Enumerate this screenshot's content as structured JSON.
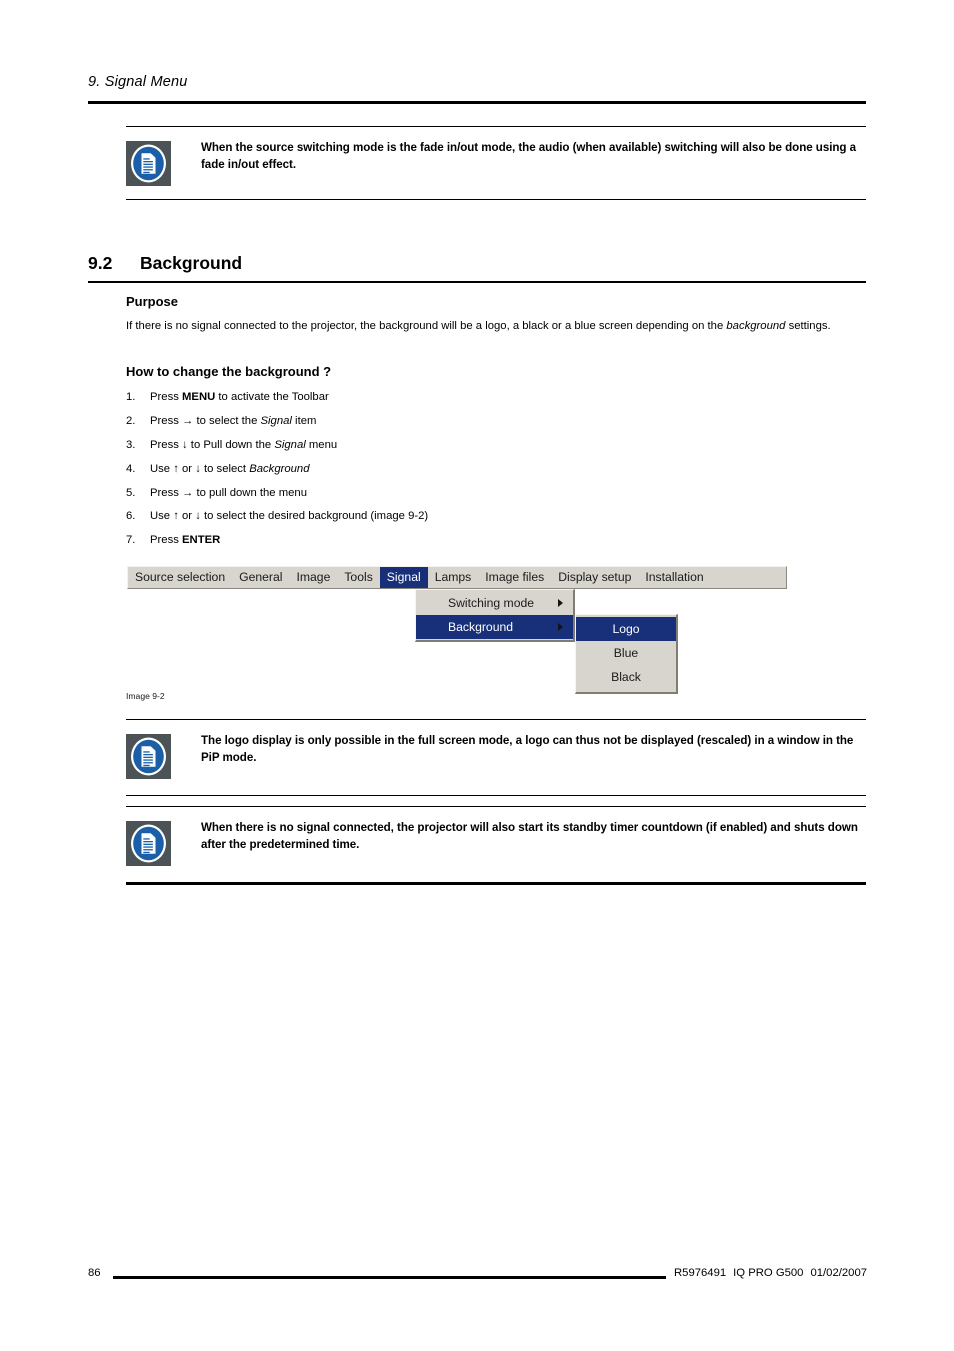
{
  "header": {
    "chapter_title": "9.  Signal Menu"
  },
  "notes": [
    {
      "icon": "note-document-icon",
      "text": "When the source switching mode is the fade in/out mode, the audio (when available) switching will also be done using a fade in/out effect."
    },
    {
      "icon": "note-document-icon",
      "text": "The logo display is only possible in the full screen mode, a logo can thus not be displayed (rescaled) in a window in the PiP mode."
    },
    {
      "icon": "note-document-icon",
      "text": "When there is no signal connected, the projector will also start its standby timer countdown (if enabled) and shuts down after the predetermined time."
    }
  ],
  "section": {
    "number": "9.2",
    "title": "Background"
  },
  "purpose": {
    "heading": "Purpose",
    "text_part1": "If there is no signal connected to the projector, the background will be a logo, a black or a blue screen depending on the ",
    "text_italic": "background",
    "text_part2": " settings."
  },
  "howto": {
    "heading": "How to change the background ?",
    "steps": [
      {
        "marker": "1.",
        "parts": [
          {
            "t": "Press ",
            "s": "normal"
          },
          {
            "t": "MENU",
            "s": "bold"
          },
          {
            "t": " to activate the Toolbar",
            "s": "normal"
          }
        ]
      },
      {
        "marker": "2.",
        "parts": [
          {
            "t": "Press → to select the ",
            "s": "normal"
          },
          {
            "t": "Signal",
            "s": "italic"
          },
          {
            "t": " item",
            "s": "normal"
          }
        ]
      },
      {
        "marker": "3.",
        "parts": [
          {
            "t": "Press ↓ to Pull down the ",
            "s": "normal"
          },
          {
            "t": "Signal",
            "s": "italic"
          },
          {
            "t": " menu",
            "s": "normal"
          }
        ]
      },
      {
        "marker": "4.",
        "parts": [
          {
            "t": "Use ↑ or ↓ to select ",
            "s": "normal"
          },
          {
            "t": "Background",
            "s": "italic"
          }
        ]
      },
      {
        "marker": "5.",
        "parts": [
          {
            "t": "Press → to pull down the menu",
            "s": "normal"
          }
        ]
      },
      {
        "marker": "6.",
        "parts": [
          {
            "t": "Use ↑ or ↓ to select the desired background (image 9-2)",
            "s": "normal"
          }
        ]
      },
      {
        "marker": "7.",
        "parts": [
          {
            "t": "Press ",
            "s": "normal"
          },
          {
            "t": "ENTER",
            "s": "bold"
          }
        ]
      }
    ]
  },
  "figure": {
    "caption": "Image 9-2",
    "colors": {
      "menu_face": "#d8d5ce",
      "highlight": "#18307a",
      "highlight_text": "#ffffff",
      "menu_text": "#1a1a1a"
    },
    "menubar": [
      {
        "label": "Source selection",
        "selected": false
      },
      {
        "label": "General",
        "selected": false
      },
      {
        "label": "Image",
        "selected": false
      },
      {
        "label": "Tools",
        "selected": false
      },
      {
        "label": "Signal",
        "selected": true
      },
      {
        "label": "Lamps",
        "selected": false
      },
      {
        "label": "Image files",
        "selected": false
      },
      {
        "label": "Display setup",
        "selected": false
      },
      {
        "label": "Installation",
        "selected": false
      }
    ],
    "dropdown": [
      {
        "label": "Switching mode",
        "selected": false,
        "has_submenu": true
      },
      {
        "label": "Background",
        "selected": true,
        "has_submenu": true
      }
    ],
    "submenu": [
      {
        "label": "Logo",
        "selected": true
      },
      {
        "label": "Blue",
        "selected": false
      },
      {
        "label": "Black",
        "selected": false
      }
    ]
  },
  "footer": {
    "page_number": "86",
    "part_number": "R5976491",
    "product": "IQ PRO G500",
    "date": "01/02/2007"
  }
}
